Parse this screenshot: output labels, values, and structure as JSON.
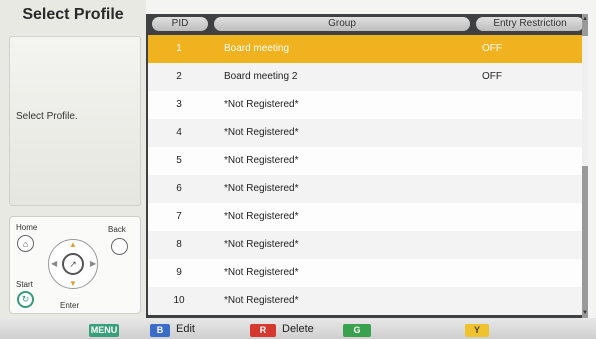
{
  "screen": {
    "title": "Select Profile",
    "description": "Select Profile."
  },
  "remote": {
    "home_label": "Home",
    "back_label": "Back",
    "start_label": "Start",
    "enter_label": "Enter"
  },
  "table": {
    "headers": {
      "pid": "PID",
      "group": "Group",
      "entry": "Entry Restriction"
    },
    "rows": [
      {
        "pid": "1",
        "group": "Board meeting",
        "entry": "OFF"
      },
      {
        "pid": "2",
        "group": "Board meeting 2",
        "entry": "OFF"
      },
      {
        "pid": "3",
        "group": "*Not Registered*",
        "entry": ""
      },
      {
        "pid": "4",
        "group": "*Not Registered*",
        "entry": ""
      },
      {
        "pid": "5",
        "group": "*Not Registered*",
        "entry": ""
      },
      {
        "pid": "6",
        "group": "*Not Registered*",
        "entry": ""
      },
      {
        "pid": "7",
        "group": "*Not Registered*",
        "entry": ""
      },
      {
        "pid": "8",
        "group": "*Not Registered*",
        "entry": ""
      },
      {
        "pid": "9",
        "group": "*Not Registered*",
        "entry": ""
      },
      {
        "pid": "10",
        "group": "*Not Registered*",
        "entry": ""
      }
    ],
    "selected_index": 0
  },
  "bottom_bar": {
    "menu_key": "MENU",
    "b_key": "B",
    "b_label": "Edit",
    "r_key": "R",
    "r_label": "Delete",
    "g_key": "G",
    "y_key": "Y"
  },
  "colors": {
    "selected_row": "#f0b21e",
    "key_menu": "#36a07a",
    "key_b": "#3a6cc8",
    "key_r": "#d4382e",
    "key_g": "#3aa24e",
    "key_y": "#efc22e"
  }
}
